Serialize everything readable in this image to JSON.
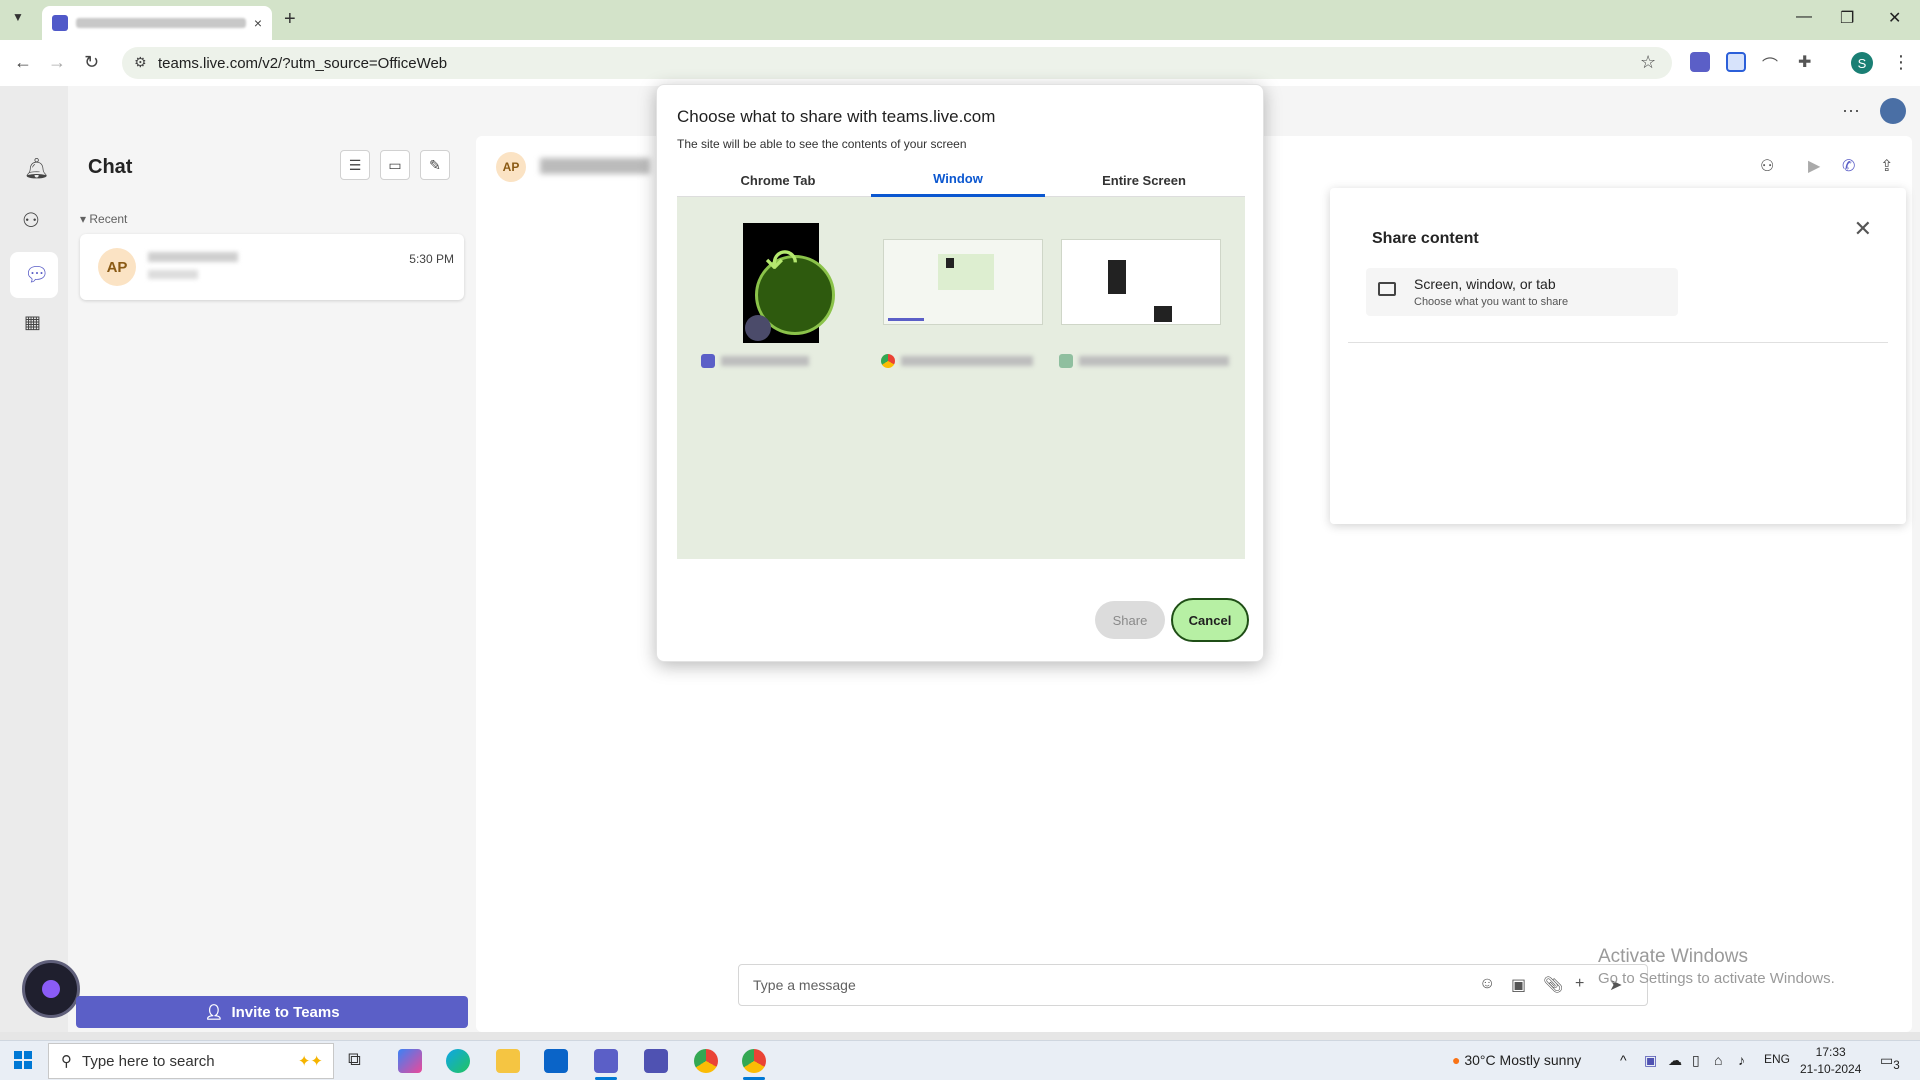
{
  "browser": {
    "tab_close": "×",
    "new_tab": "+",
    "url": "teams.live.com/v2/?utm_source=OfficeWeb",
    "profile_initial": "S"
  },
  "teams": {
    "chat_title": "Chat",
    "recent_label": "Recent",
    "chat_item": {
      "initials": "AP",
      "time": "5:30 PM"
    },
    "conversation_initials": "AP",
    "invite_label": "Invite to Teams",
    "compose_placeholder": "Type a message"
  },
  "share_panel": {
    "title": "Share content",
    "option_title": "Screen, window, or tab",
    "option_subtitle": "Choose what you want to share"
  },
  "dialog": {
    "title": "Choose what to share with teams.live.com",
    "subtitle": "The site will be able to see the contents of your screen",
    "tabs": [
      {
        "label": "Chrome Tab",
        "active": false
      },
      {
        "label": "Window",
        "active": true
      },
      {
        "label": "Entire Screen",
        "active": false
      }
    ],
    "share_label": "Share",
    "cancel_label": "Cancel"
  },
  "watermark": {
    "line1": "Activate Windows",
    "line2": "Go to Settings to activate Windows."
  },
  "taskbar": {
    "search_placeholder": "Type here to search",
    "weather": "30°C  Mostly sunny",
    "language": "ENG",
    "time": "17:33",
    "date": "21-10-2024",
    "notifications": "3"
  },
  "colors": {
    "accent": "#5b5fc7",
    "chrome_blue": "#0b57d0",
    "cancel_bg": "#b7f0a4"
  }
}
